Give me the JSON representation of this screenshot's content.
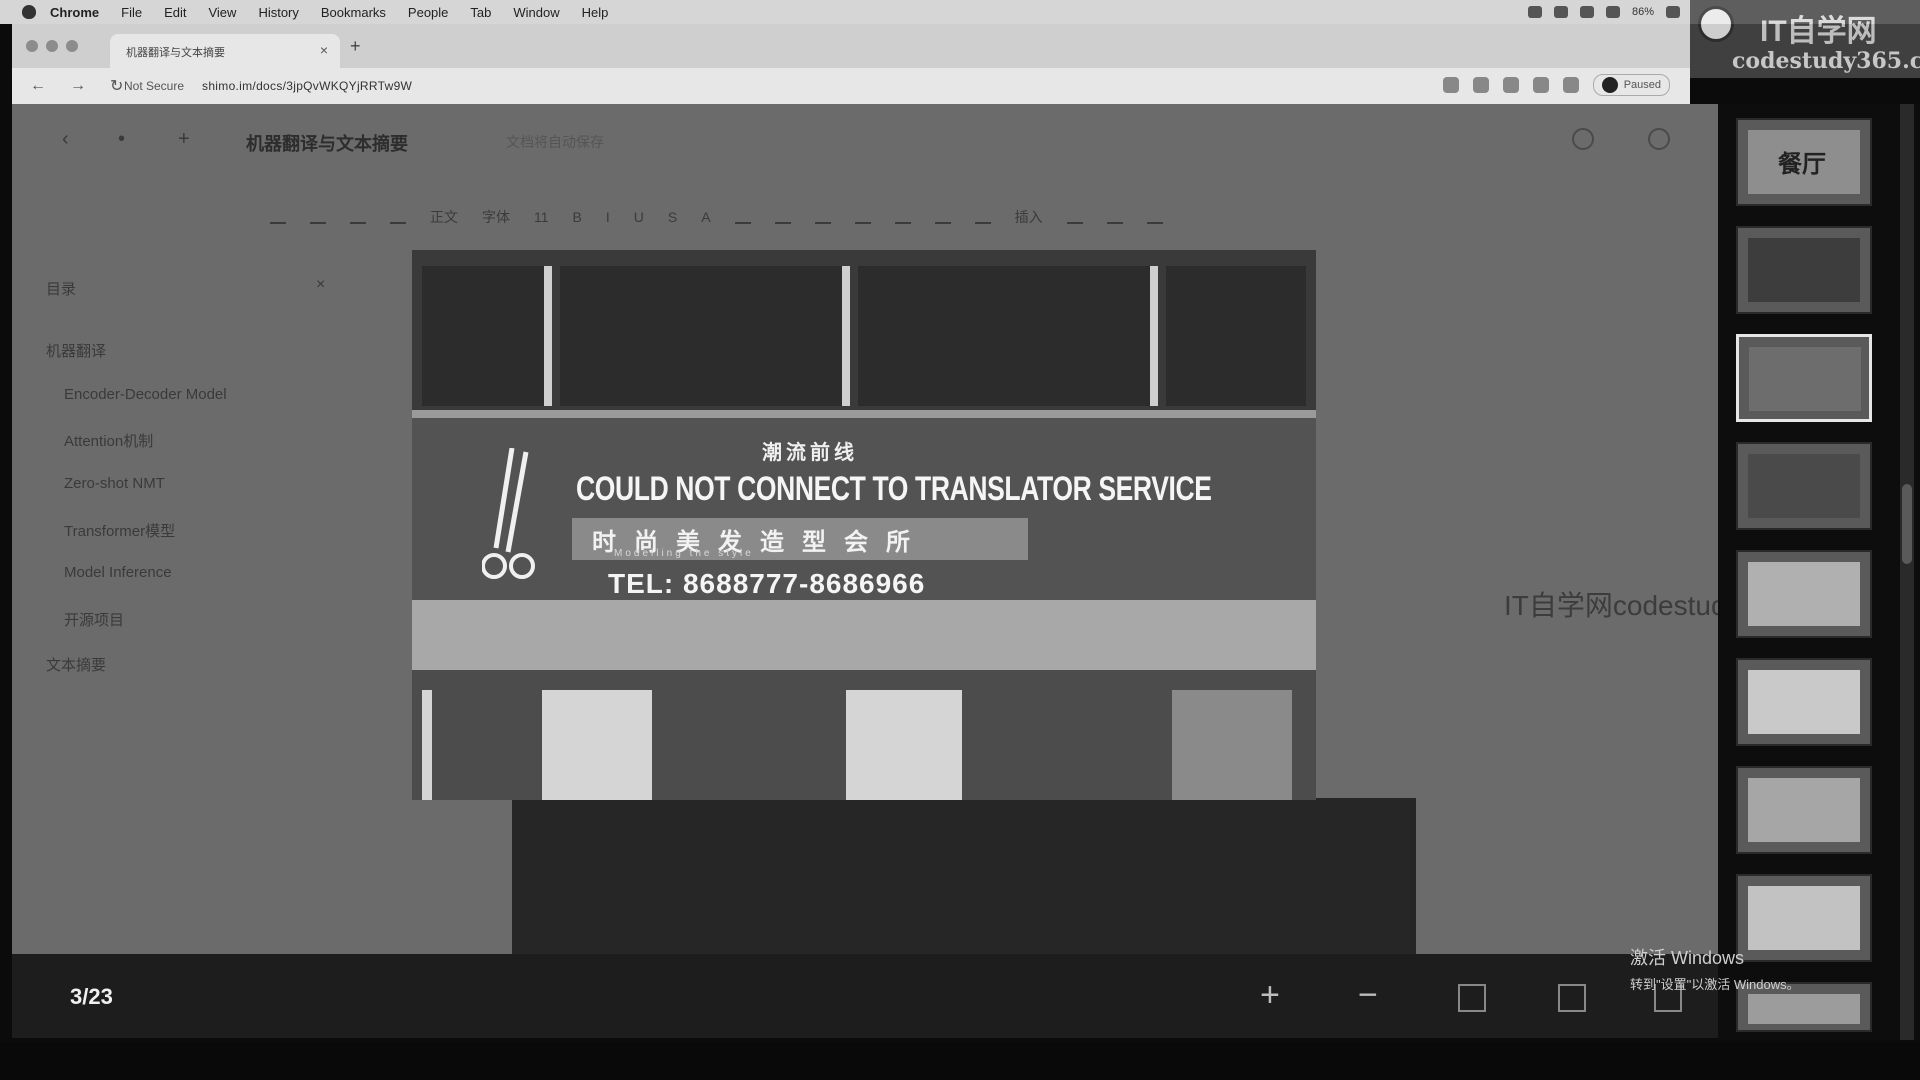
{
  "menubar": {
    "items": [
      "Chrome",
      "File",
      "Edit",
      "View",
      "History",
      "Bookmarks",
      "People",
      "Tab",
      "Window",
      "Help"
    ],
    "battery": "86%",
    "paused": "Paused"
  },
  "browser": {
    "tab_title": "机器翻译与文本摘要",
    "security": "Not Secure",
    "url": "shimo.im/docs/3jpQvWKQYjRRTw9W"
  },
  "watermark": {
    "brand": "IT自学网",
    "domain": "codestudy365.com",
    "overlay_text": "IT自学网codestudy365.com"
  },
  "doc": {
    "title": "机器翻译与文本摘要",
    "status": "文档将自动保存",
    "toolbar": [
      "正文",
      "字体",
      "11",
      "B",
      "I",
      "U",
      "S",
      "A",
      "插入"
    ],
    "outline_title": "目录",
    "outline": [
      "机器翻译",
      "Encoder-Decoder Model",
      "Attention机制",
      "Zero-shot NMT",
      "Transformer模型",
      "Model Inference",
      "开源项目",
      "文本摘要"
    ]
  },
  "image": {
    "sign_line1": "潮流前线",
    "sign_line2": "COULD NOT CONNECT TO TRANSLATOR SERVICE",
    "sign_line3": "时尚美发造型会所",
    "sign_line4": "Modelling the style",
    "sign_line5": "TEL: 8688777-8686966"
  },
  "viewer": {
    "counter": "3/23",
    "zoom_in": "+",
    "zoom_out": "−"
  },
  "windows_activation": {
    "line1": "激活 Windows",
    "line2": "转到\"设置\"以激活 Windows。"
  },
  "thumbnails": {
    "count_visible": 9,
    "active_index": 2,
    "first_label": "餐厅"
  }
}
